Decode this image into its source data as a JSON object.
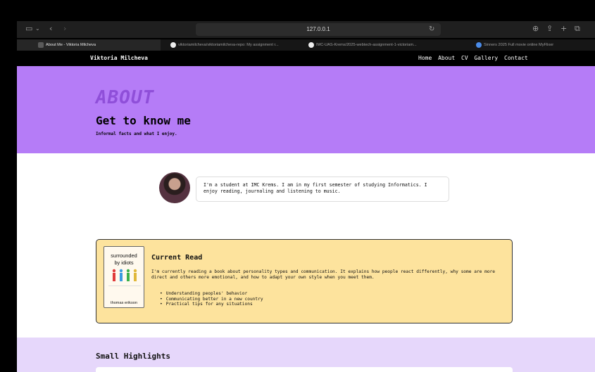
{
  "browser": {
    "url": "127.0.0.1",
    "tabs": [
      {
        "label": "About Me - Viktoria Milcheva",
        "active": true
      },
      {
        "label": "viktoriamilcheva/viktoriamilcheva-repo: My assignment r...",
        "active": false
      },
      {
        "label": "IMC-UAS-Krems/2025-webtech-assignment-1-victoriam...",
        "active": false
      },
      {
        "label": "Sinners 2025 Full movie online MyFlixer",
        "active": false
      }
    ]
  },
  "nav": {
    "brand": "Viktoria Milcheva",
    "links": [
      "Home",
      "About",
      "CV",
      "Gallery",
      "Contact"
    ]
  },
  "hero": {
    "eyebrow": "ABOUT",
    "title": "Get to know me",
    "subtitle": "Informal facts and what I enjoy."
  },
  "intro": {
    "text": "I'm a student at IMC Krems. I am in my first semester of studying Informatics. I enjoy reading, journaling and listening to music."
  },
  "current_read": {
    "title": "Current Read",
    "text": "I'm currently reading a book about personality types and communication. It explains how people react differently, why some are more direct and others more emotional, and how to adapt your own style when you meet them.",
    "bullets": [
      "Understanding peoples' behavior",
      "Communicating better in a new country",
      "Practical tips for any situations"
    ],
    "book": {
      "title_line1": "surrounded",
      "title_line2": "by idiots",
      "author": "thomas erikson"
    }
  },
  "highlights": {
    "title": "Small Highlights"
  },
  "colors": {
    "hero_bg": "#b57cf7",
    "card_bg": "#fde39d",
    "highlights_bg": "#e6d7fb"
  }
}
